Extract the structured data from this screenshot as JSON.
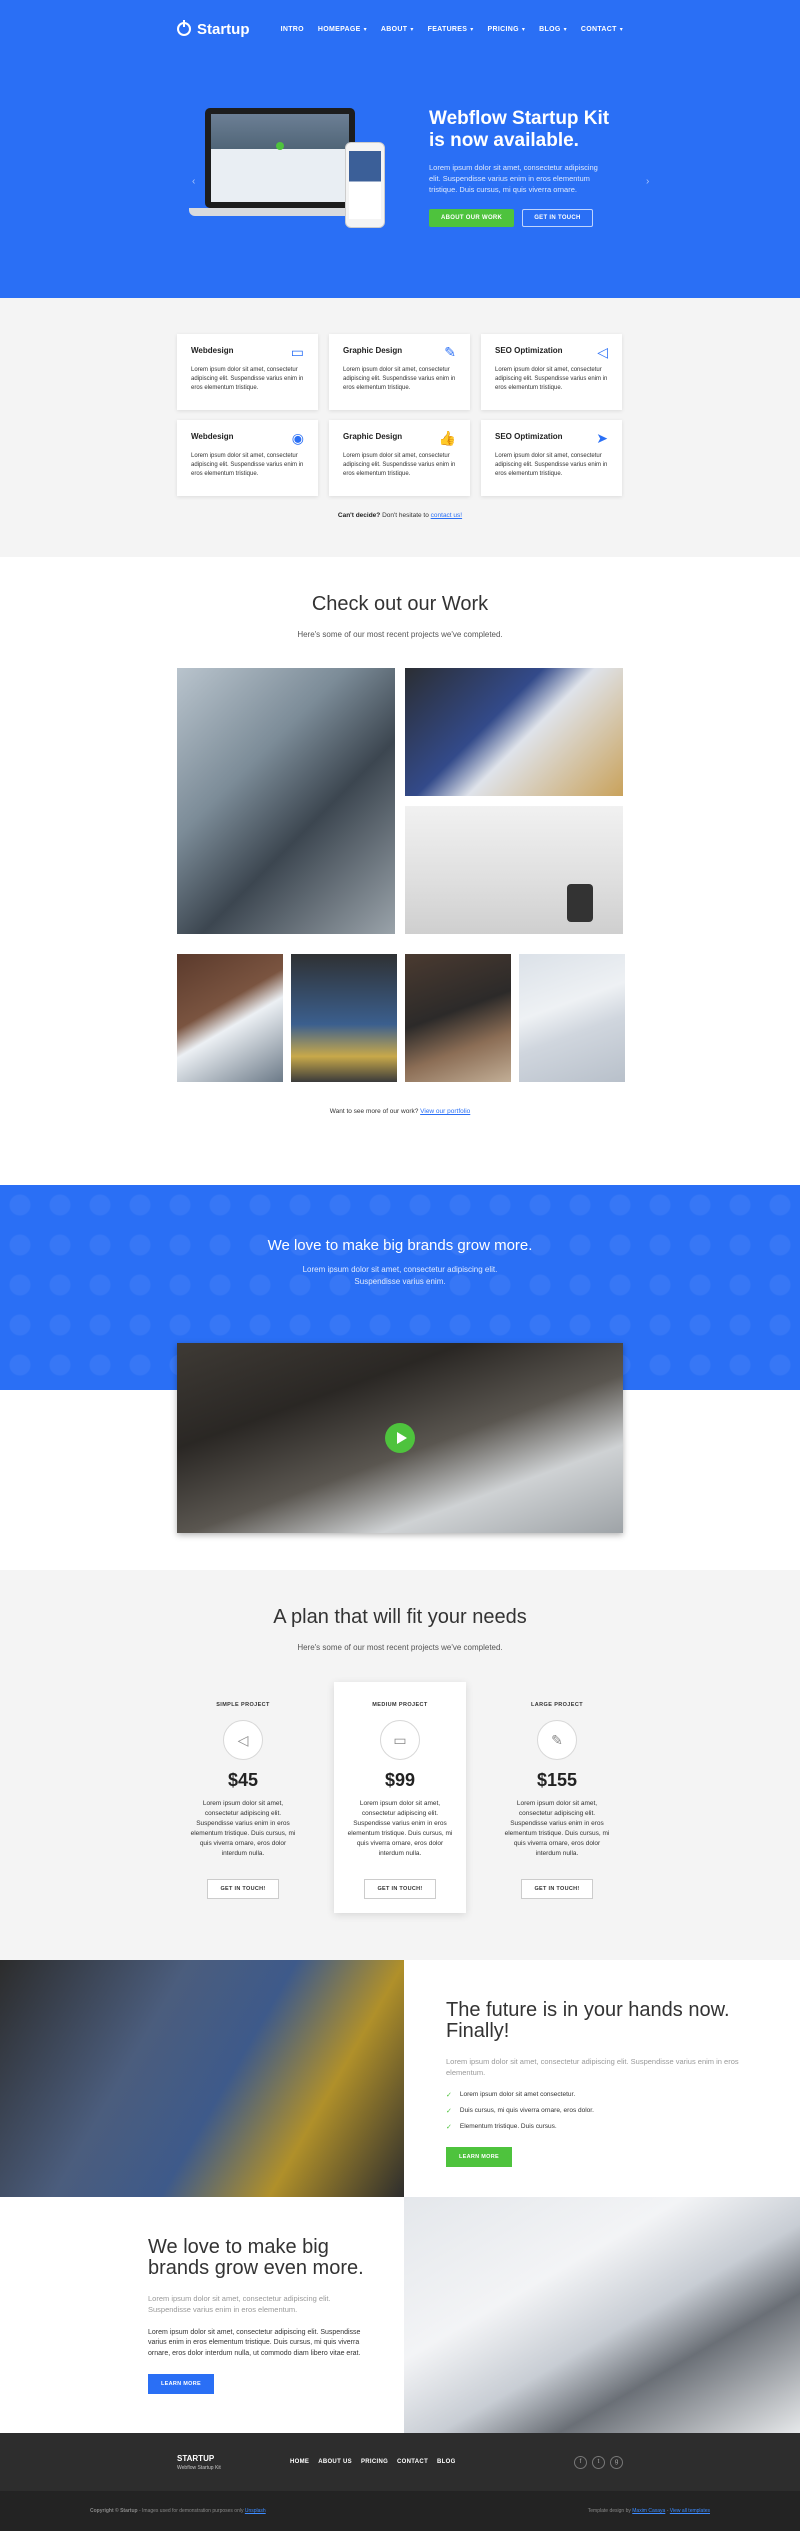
{
  "nav": {
    "logo": "Startup",
    "items": [
      {
        "label": "INTRO",
        "caret": false
      },
      {
        "label": "HOMEPAGE",
        "caret": true
      },
      {
        "label": "ABOUT",
        "caret": true
      },
      {
        "label": "FEATURES",
        "caret": true
      },
      {
        "label": "PRICING",
        "caret": true
      },
      {
        "label": "BLOG",
        "caret": true
      },
      {
        "label": "CONTACT",
        "caret": true
      }
    ]
  },
  "hero": {
    "title": "Webflow Startup Kit is now available.",
    "description": "Lorem ipsum dolor sit amet, consectetur adipiscing elit. Suspendisse varius enim in eros elementum tristique. Duis cursus, mi quis viverra ornare.",
    "primary_btn": "ABOUT OUR WORK",
    "secondary_btn": "GET IN TOUCH",
    "prev_icon": "chevron-left",
    "next_icon": "chevron-right"
  },
  "services": {
    "items": [
      {
        "title": "Webdesign",
        "icon": "monitor-icon",
        "glyph": "▭",
        "desc": "Lorem ipsum dolor sit amet, consectetur adipiscing elit. Suspendisse varius enim in eros elementum tristique."
      },
      {
        "title": "Graphic Design",
        "icon": "pencil-icon",
        "glyph": "✎",
        "desc": "Lorem ipsum dolor sit amet, consectetur adipiscing elit. Suspendisse varius enim in eros elementum tristique."
      },
      {
        "title": "SEO Optimization",
        "icon": "megaphone-icon",
        "glyph": "◁",
        "desc": "Lorem ipsum dolor sit amet, consectetur adipiscing elit. Suspendisse varius enim in eros elementum tristique."
      },
      {
        "title": "Webdesign",
        "icon": "camera-icon",
        "glyph": "◉",
        "desc": "Lorem ipsum dolor sit amet, consectetur adipiscing elit. Suspendisse varius enim in eros elementum tristique."
      },
      {
        "title": "Graphic Design",
        "icon": "thumbs-up-icon",
        "glyph": "👍",
        "desc": "Lorem ipsum dolor sit amet, consectetur adipiscing elit. Suspendisse varius enim in eros elementum tristique."
      },
      {
        "title": "SEO Optimization",
        "icon": "paper-plane-icon",
        "glyph": "➤",
        "desc": "Lorem ipsum dolor sit amet, consectetur adipiscing elit. Suspendisse varius enim in eros elementum tristique."
      }
    ],
    "note_bold": "Can't decide?",
    "note_text": " Don't hesitate to ",
    "note_link": "contact us!"
  },
  "work": {
    "title": "Check out our Work",
    "subtitle": "Here's some of our most recent projects we've completed.",
    "note_text": "Want to see more of our work? ",
    "note_link": "View our portfolio"
  },
  "brands": {
    "title": "We love to make big brands grow more.",
    "desc_line1": "Lorem ipsum dolor sit amet, consectetur adipiscing elit.",
    "desc_line2": "Suspendisse varius enim."
  },
  "pricing": {
    "title": "A plan that will fit your needs",
    "subtitle": "Here's some of our most recent projects we've completed.",
    "plans": [
      {
        "name": "SIMPLE PROJECT",
        "icon": "megaphone-icon",
        "glyph": "◁",
        "price": "$45",
        "desc": "Lorem ipsum dolor sit amet, consectetur adipiscing elit. Suspendisse varius enim in eros elementum tristique. Duis cursus, mi quis viverra ornare, eros dolor interdum nulla.",
        "btn": "GET IN TOUCH!"
      },
      {
        "name": "MEDIUM PROJECT",
        "icon": "monitor-icon",
        "glyph": "▭",
        "price": "$99",
        "desc": "Lorem ipsum dolor sit amet, consectetur adipiscing elit. Suspendisse varius enim in eros elementum tristique. Duis cursus, mi quis viverra ornare, eros dolor interdum nulla.",
        "btn": "GET IN TOUCH!"
      },
      {
        "name": "LARGE PROJECT",
        "icon": "pencil-icon",
        "glyph": "✎",
        "price": "$155",
        "desc": "Lorem ipsum dolor sit amet, consectetur adipiscing elit. Suspendisse varius enim in eros elementum tristique. Duis cursus, mi quis viverra ornare, eros dolor interdum nulla.",
        "btn": "GET IN TOUCH!"
      }
    ]
  },
  "future": {
    "title": "The future is in your hands now. Finally!",
    "desc": "Lorem ipsum dolor sit amet, consectetur adipiscing elit. Suspendisse varius enim in eros elementum.",
    "checks": [
      "Lorem ipsum dolor sit amet consectetur.",
      "Duis cursus, mi quis viverra ornare, eros dolor.",
      "Elementum tristique. Duis cursus."
    ],
    "btn": "LEARN MORE"
  },
  "grow": {
    "title": "We love to make big brands grow even more.",
    "desc": "Lorem ipsum dolor sit amet, consectetur adipiscing elit. Suspendisse varius enim in eros elementum.",
    "desc2": "Lorem ipsum dolor sit amet, consectetur adipiscing elit. Suspendisse varius enim in eros elementum tristique. Duis cursus, mi quis viverra ornare, eros dolor interdum nulla, ut commodo diam libero vitae erat.",
    "btn": "LEARN MORE"
  },
  "footer": {
    "logo": "STARTUP",
    "tagline": "Webflow Startup Kit",
    "links": [
      "HOME",
      "ABOUT US",
      "PRICING",
      "CONTACT",
      "BLOG"
    ],
    "social": [
      {
        "icon": "facebook-icon",
        "glyph": "f"
      },
      {
        "icon": "twitter-icon",
        "glyph": "t"
      },
      {
        "icon": "google-plus-icon",
        "glyph": "g"
      }
    ],
    "copyright_prefix": "Copyright © Startup",
    "copyright_rest": " - Images used for demonstration purposes only ",
    "copyright_link": "Unsplash",
    "credit_prefix": "Template design by ",
    "credit_link1": "Maxim Caxaya",
    "credit_mid": " - ",
    "credit_link2": "View all templates"
  },
  "colors": {
    "brand_blue": "#2a6ff5",
    "accent_green": "#4ec33d",
    "footer_dark": "#2d2d2d"
  }
}
